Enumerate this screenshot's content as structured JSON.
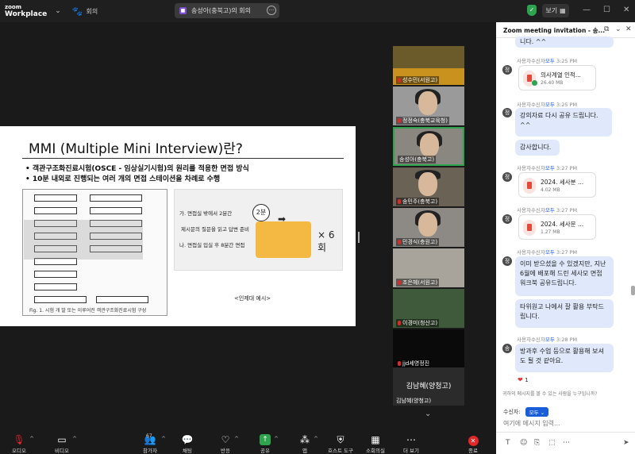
{
  "topbar": {
    "logo_line1": "zoom",
    "logo_line2": "Workplace",
    "meeting_label": "회의",
    "meeting_title": "송성아(충북고)의 회의",
    "view_label": "보기"
  },
  "slide": {
    "title": "MMI (Multiple Mini Interview)란?",
    "bullet1": "• 객관구조화진료시험(OSCE - 임상실기시험)의 원리를 적용한 면접 방식",
    "bullet2": "• 10분 내외로 진행되는 여러 개의 면접 스테이션을 차례로 수행",
    "fig_caption": "Fig. 1. 시험 개 발 또는 이루어진 객관구조화진료시험 구성",
    "panel_text1": "가. 면접실 밖에서 2분간",
    "panel_text2": "제시문의 질문을 읽고 답변 준비",
    "panel_text3": "나. 면접실 입실 후 8분간 면접",
    "panel_badge": "2분",
    "panel_times": "× 6회",
    "source_note": "<인제대 예시>"
  },
  "tiles": [
    {
      "name": "성수민(서원고)",
      "active": false
    },
    {
      "name": "정정숙(충북교육청)",
      "active": false
    },
    {
      "name": "송성아(충북고)",
      "active": true
    },
    {
      "name": "송민주(충북고)",
      "active": false
    },
    {
      "name": "민경식(충원고)",
      "active": false
    },
    {
      "name": "조은혜(서원고)",
      "active": false
    },
    {
      "name": "이경미(청산고)",
      "active": false
    },
    {
      "name": "jjd세영정진",
      "active": false
    }
  ],
  "name_tile": {
    "big": "김남혜(양청고)",
    "small": "김남혜(양청고)"
  },
  "chat": {
    "header": "Zoom meeting invitation - 송...",
    "messages": [
      {
        "type": "text",
        "text": "니다. ^^"
      },
      {
        "type": "meta",
        "sender": "사용자수신자",
        "to": "모두",
        "time": "3:25 PM"
      },
      {
        "type": "file",
        "name": "의사계열 인적...",
        "size": "26.40 MB"
      },
      {
        "type": "meta",
        "sender": "사용자수신자",
        "to": "모두",
        "time": "3:25 PM"
      },
      {
        "type": "text",
        "text": "강의자료 다시 공유 드립니다. ^^"
      },
      {
        "type": "text",
        "text": "감사합니다."
      },
      {
        "type": "meta",
        "sender": "사용자수신자",
        "to": "모두",
        "time": "3:27 PM"
      },
      {
        "type": "file",
        "name": "2024. 세사분 ...",
        "size": "4.02 MB"
      },
      {
        "type": "meta",
        "sender": "사용자수신자",
        "to": "모두",
        "time": "3:27 PM"
      },
      {
        "type": "file",
        "name": "2024. 세사문 ...",
        "size": "1.27 MB"
      },
      {
        "type": "meta",
        "sender": "사용자수신자",
        "to": "모두",
        "time": "3:27 PM"
      },
      {
        "type": "text",
        "text": "이미 받으셨을 수 있겠지만, 지난 6월에 배포해 드린 세사모 면접 워크북 공유드립니다."
      },
      {
        "type": "text",
        "text": "타위원고 나에서 잘 활용 부탁드립니다."
      },
      {
        "type": "meta",
        "sender": "사용자수신자",
        "to": "모두",
        "time": "3:28 PM"
      },
      {
        "type": "text",
        "text": "방과후 수업 등으로 활용해 보셔도 될 것 같아요."
      }
    ],
    "reaction_count": "1",
    "notice": "귀하의 메시지를 볼 수 있는 사람을 누구입니까?",
    "to_label": "수신자:",
    "to_value": "모두",
    "input_placeholder": "여기에 메시지 입력..."
  },
  "toolbar": {
    "audio": "오디오",
    "video": "비디오",
    "participants": "참가자",
    "participants_count": "67",
    "chat": "채팅",
    "react": "반응",
    "share": "공유",
    "apps": "앱",
    "host_tools": "호스트 도구",
    "more_apps": "소회의실",
    "more": "더 보기",
    "end": "종료"
  }
}
